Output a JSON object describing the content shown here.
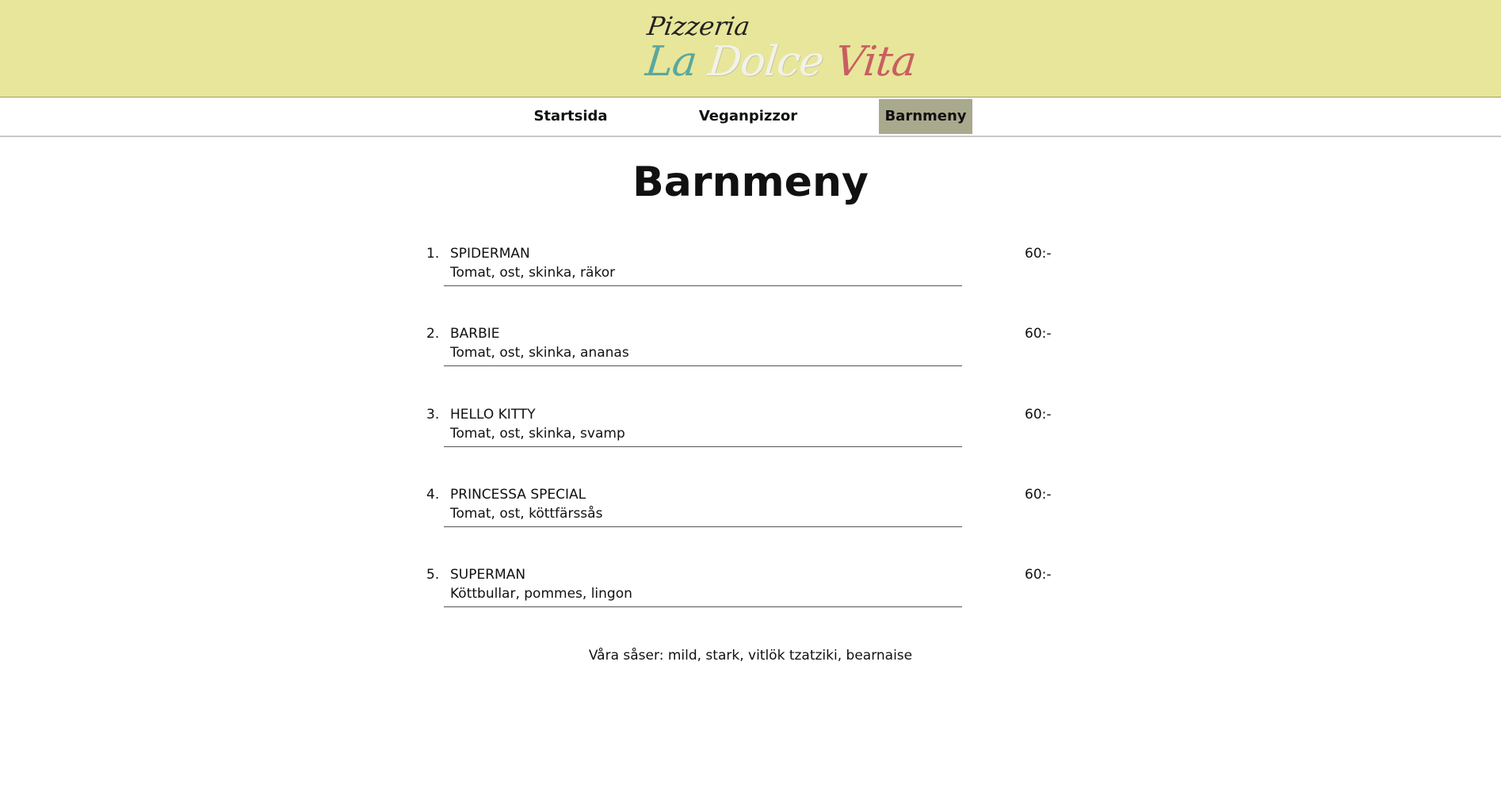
{
  "header": {
    "logo": {
      "small_text": "Pizzeria",
      "big_text_1": "La",
      "big_text_2": "Dolce",
      "big_text_3": "Vita"
    }
  },
  "nav": {
    "items": [
      {
        "label": "Startsida",
        "active": false
      },
      {
        "label": "Veganpizzor",
        "active": false
      },
      {
        "label": "Barnmeny",
        "active": true
      }
    ]
  },
  "page": {
    "title": "Barnmeny"
  },
  "menu": {
    "items": [
      {
        "number": "1.",
        "name": "SPIDERMAN",
        "description": "Tomat, ost, skinka, räkor",
        "price": "60:-"
      },
      {
        "number": "2.",
        "name": "BARBIE",
        "description": "Tomat, ost, skinka, ananas",
        "price": "60:-"
      },
      {
        "number": "3.",
        "name": "HELLO KITTY",
        "description": "Tomat, ost, skinka, svamp",
        "price": "60:-"
      },
      {
        "number": "4.",
        "name": "PRINCESSA SPECIAL",
        "description": "Tomat, ost, köttfärssås",
        "price": "60:-"
      },
      {
        "number": "5.",
        "name": "SUPERMAN",
        "description": "Köttbullar, pommes, lingon",
        "price": "60:-"
      }
    ]
  },
  "footer": {
    "sauces": "Våra såser: mild, stark, vitlök tzatziki, bearnaise"
  },
  "colors": {
    "header_bg": "#e8e69a",
    "nav_active_bg": "#a9a98e",
    "logo_la": "#5aa89e",
    "logo_vita": "#c85f62"
  }
}
